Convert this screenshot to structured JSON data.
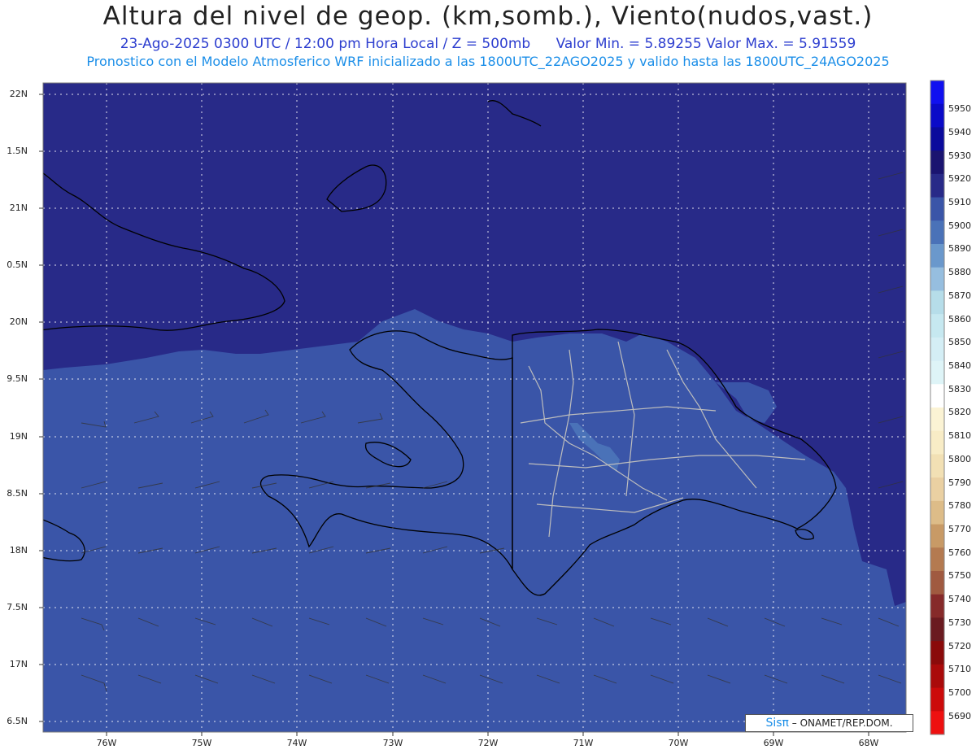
{
  "header": {
    "title": "Altura del nivel de geop. (km,somb.), Viento(nudos,vast.)",
    "date": "23-Ago-2025",
    "time_utc": "0300 UTC / 12:00 pm Hora Local / Z = 500mb",
    "min_value": "Valor Min. = 5.89255",
    "max_value": "Valor Max. = 5.91559",
    "forecast_note": "Pronostico con el Modelo Atmosferico WRF inicializado a las 1800UTC_22AGO2025 y valido hasta las  1800UTC_24AGO2025"
  },
  "map": {
    "ocean_colors": {
      "high_north": "#282a88",
      "main": "#3a55a8",
      "light": "#4a72b8"
    },
    "coast_color": "#000000",
    "border_color": "#bdbdbd",
    "lat_labels": [
      "22N",
      "1.5N",
      "21N",
      "0.5N",
      "20N",
      "9.5N",
      "19N",
      "8.5N",
      "18N",
      "7.5N",
      "17N",
      "6.5N"
    ],
    "lon_labels": [
      "76W",
      "75W",
      "74W",
      "73W",
      "72W",
      "71W",
      "70W",
      "69W",
      "68W"
    ]
  },
  "colorbar": {
    "labels": [
      "5950",
      "5940",
      "5930",
      "5920",
      "5910",
      "5900",
      "5890",
      "5880",
      "5870",
      "5860",
      "5850",
      "5840",
      "5830",
      "5820",
      "5810",
      "5800",
      "5790",
      "5780",
      "5770",
      "5760",
      "5750",
      "5740",
      "5730",
      "5720",
      "5710",
      "5700",
      "5690"
    ],
    "colors": [
      "#1010f0",
      "#0a0ac8",
      "#0a0a9c",
      "#1a1470",
      "#282a88",
      "#3a55a8",
      "#4a72b8",
      "#6a98cc",
      "#96bedf",
      "#b6dde9",
      "#c6e8f0",
      "#d4eef5",
      "#def4f7",
      "#ffffff",
      "#fbf3d4",
      "#f8ecc6",
      "#f2e0b4",
      "#ead0a2",
      "#ddbc88",
      "#c89a66",
      "#b47a50",
      "#a05a40",
      "#862a2a",
      "#6a1a20",
      "#8a0a0a",
      "#aa0a0a",
      "#cc0a0a",
      "#ee1010"
    ]
  },
  "credit": {
    "brand": "Sisπ",
    "org": "– ONAMET/REP.DOM."
  }
}
